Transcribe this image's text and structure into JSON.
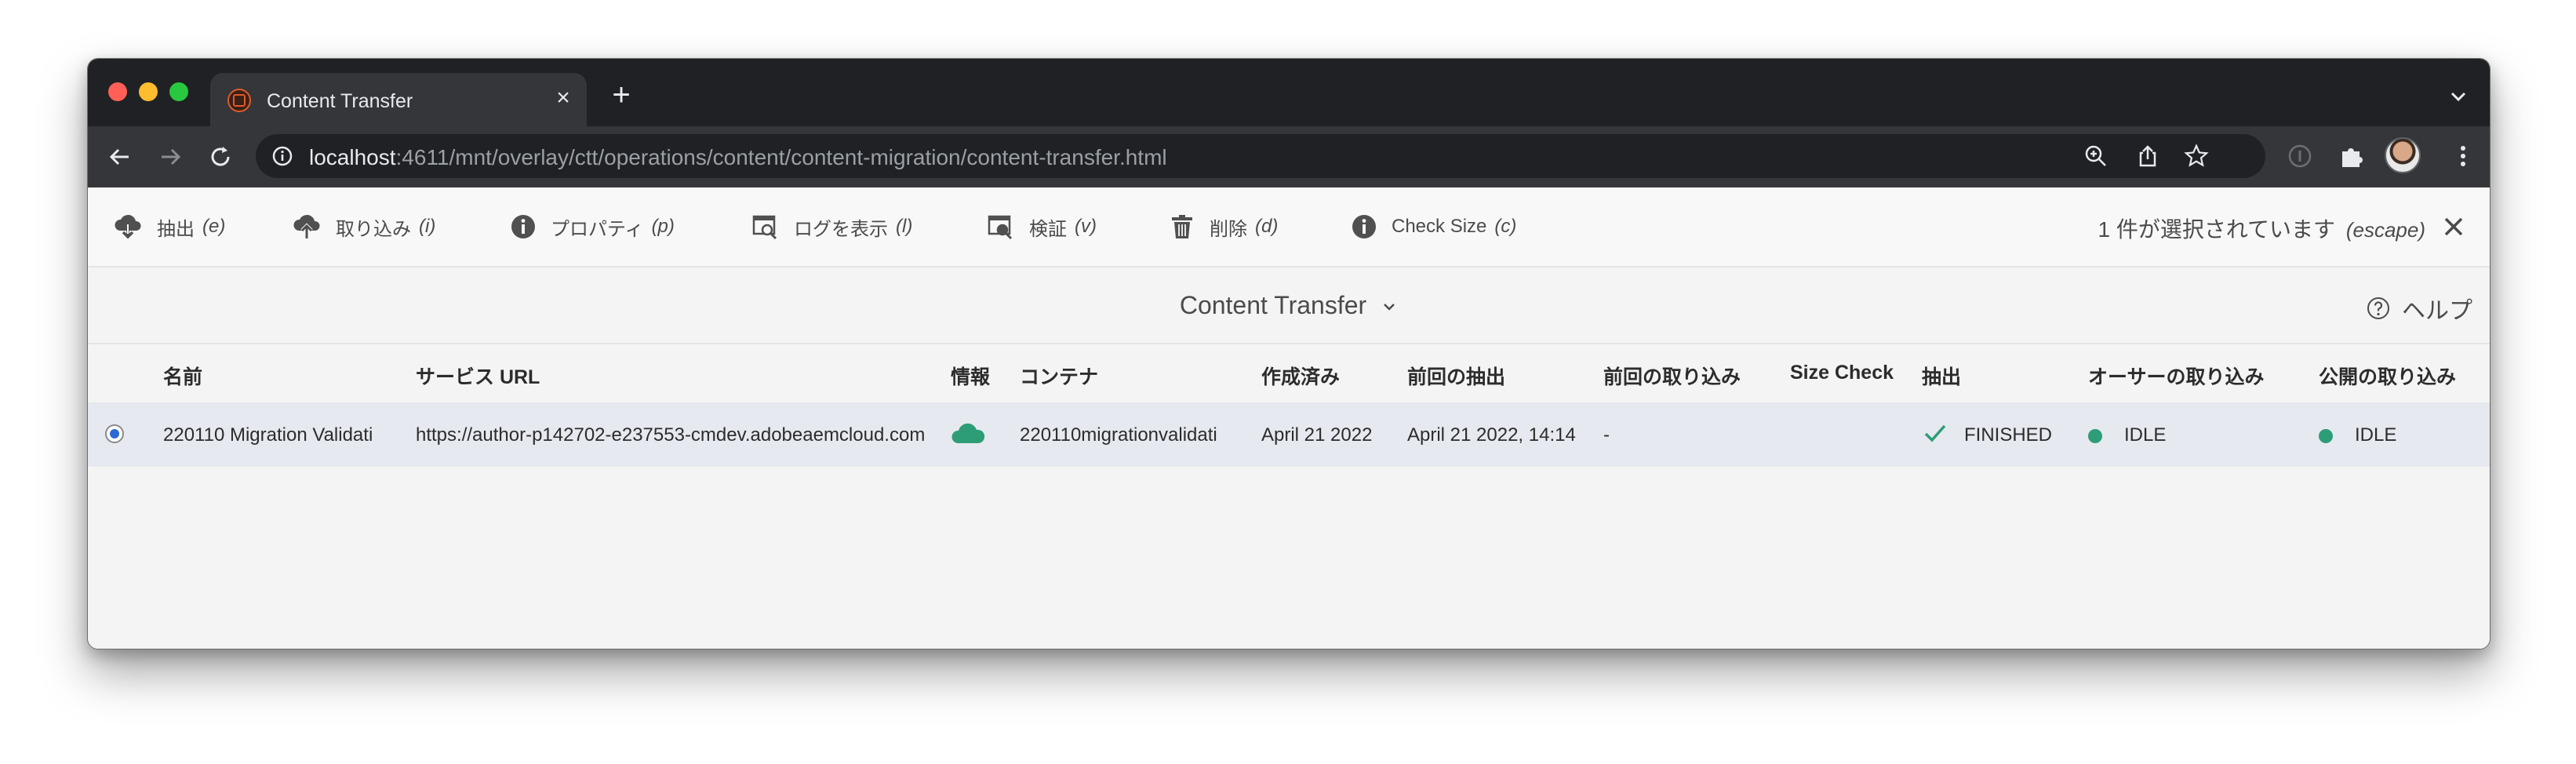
{
  "browser": {
    "tab_title": "Content Transfer",
    "url_host": "localhost",
    "url_rest": ":4611/mnt/overlay/ctt/operations/content/content-migration/content-transfer.html"
  },
  "actions": [
    {
      "label": "抽出",
      "key": "(e)",
      "icon": "cloud-download-icon"
    },
    {
      "label": "取り込み",
      "key": "(i)",
      "icon": "cloud-upload-icon"
    },
    {
      "label": "プロパティ",
      "key": "(p)",
      "icon": "info-icon"
    },
    {
      "label": "ログを表示",
      "key": "(l)",
      "icon": "view-log-icon"
    },
    {
      "label": "検証",
      "key": "(v)",
      "icon": "validate-icon"
    },
    {
      "label": "削除",
      "key": "(d)",
      "icon": "trash-icon"
    },
    {
      "label": "Check Size",
      "key": "(c)",
      "icon": "info-icon"
    }
  ],
  "selection": {
    "text": "1 件が選択されています",
    "key": "(escape)"
  },
  "page": {
    "title": "Content Transfer",
    "help_label": "ヘルプ"
  },
  "table": {
    "headers": [
      "名前",
      "サービス URL",
      "情報",
      "コンテナ",
      "作成済み",
      "前回の抽出",
      "前回の取り込み",
      "Size Check",
      "抽出",
      "オーサーの取り込み",
      "公開の取り込み"
    ],
    "rows": [
      {
        "name": "220110 Migration Validati",
        "service_url": "https://author-p142702-e237553-cmdev.adobeaemcloud.com",
        "info_icon": "cloud-icon",
        "container": "220110migrationvalidati",
        "created": "April 21 2022",
        "last_extraction": "April 21 2022, 14:14",
        "last_ingestion": "-",
        "size_check": "",
        "extraction": "FINISHED",
        "author_ingestion": "IDLE",
        "publish_ingestion": "IDLE"
      }
    ]
  },
  "colors": {
    "status_idle": "#2d9d78",
    "finished_check": "#2d9d78",
    "cloud": "#2d9d78",
    "selected_row": "#e6e9ef"
  }
}
